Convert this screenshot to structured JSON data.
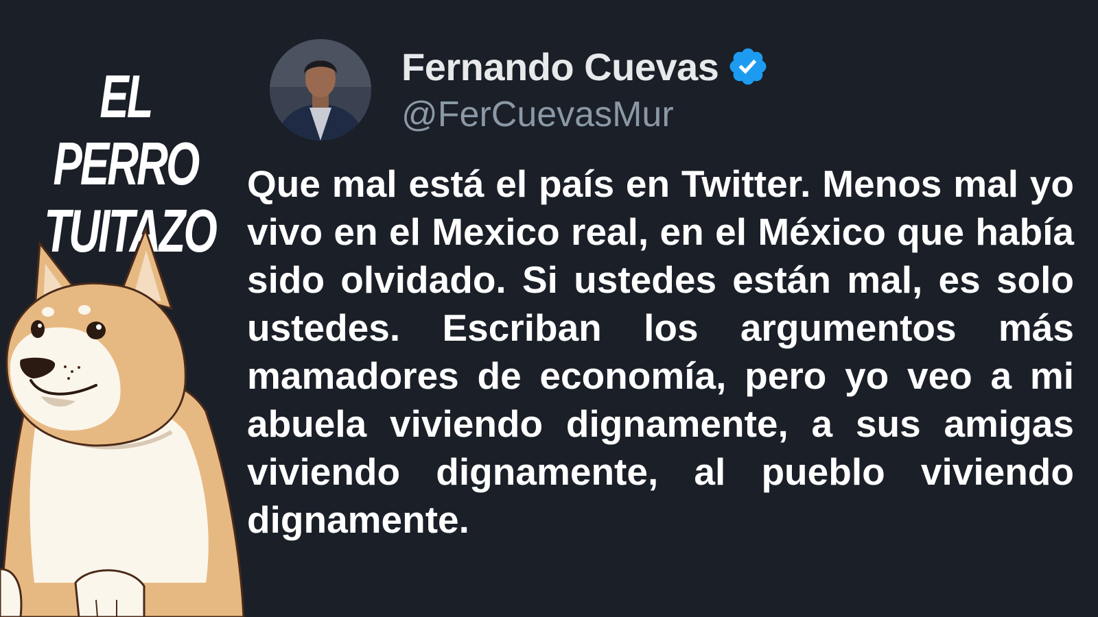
{
  "brand": {
    "line1": "EL PERRO",
    "line2": "TUITAZO"
  },
  "profile": {
    "name": "Fernando Cuevas",
    "handle": "@FerCuevasMur",
    "verified": true,
    "verified_icon": "verified-badge-icon",
    "verified_color": "#1d9bf0"
  },
  "tweet": {
    "text": "Que mal está el país en Twitter. Menos mal yo vivo en el Mexico real, en el México que había sido olvidado. Si ustedes están mal, es solo ustedes. Escriban los argumentos más mamadores de economía, pero yo veo a mi abuela viviendo dignamente, a sus amigas viviendo dignamente, al pueblo viviendo dignamente."
  },
  "colors": {
    "background": "#1a1f28",
    "text": "#ffffff",
    "handle": "#8b98a5",
    "dog_fur": "#e7b982",
    "dog_cream": "#fbf6ec"
  }
}
